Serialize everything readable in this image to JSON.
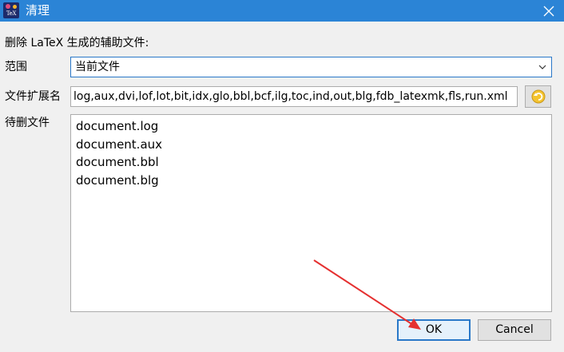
{
  "window": {
    "title": "清理",
    "icon": "texstudio-app-icon",
    "icon_text": "TeX"
  },
  "instruction": "删除 LaTeX 生成的辅助文件:",
  "scope": {
    "label": "范围",
    "selected": "当前文件"
  },
  "extensions": {
    "label": "文件扩展名",
    "value": "log,aux,dvi,lof,lot,bit,idx,glo,bbl,bcf,ilg,toc,ind,out,blg,fdb_latexmk,fls,run.xml"
  },
  "files": {
    "label": "待删文件",
    "items": [
      "document.log",
      "document.aux",
      "document.bbl",
      "document.blg"
    ]
  },
  "buttons": {
    "ok": "OK",
    "cancel": "Cancel"
  },
  "colors": {
    "titlebar": "#2b84d6",
    "focus_border": "#2a78c8",
    "annotation_arrow": "#e53030"
  }
}
